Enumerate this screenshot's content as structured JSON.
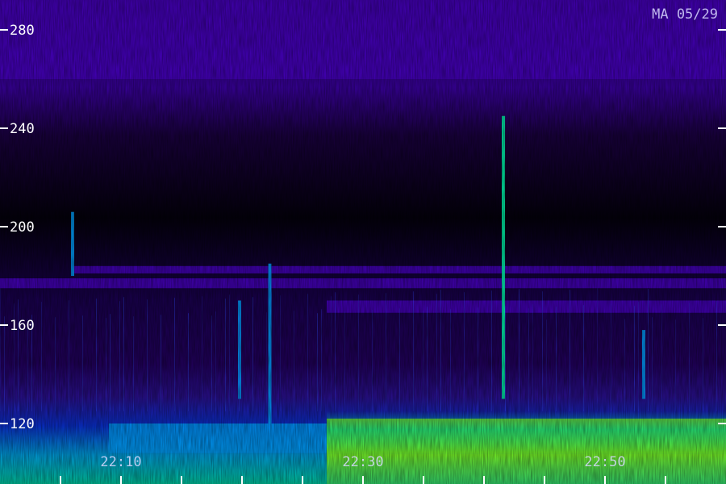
{
  "chart_data": {
    "type": "heatmap",
    "title": "",
    "corner_label": "MA 05/29",
    "xlabel": "",
    "ylabel": "",
    "ylim": [
      105,
      295
    ],
    "y_ticks": [
      120,
      160,
      200,
      240,
      280
    ],
    "x_tick_labels": [
      {
        "label": "22:10",
        "t": 10
      },
      {
        "label": "22:30",
        "t": 30
      },
      {
        "label": "22:50",
        "t": 50
      }
    ],
    "xlim": [
      0,
      60
    ],
    "x_minor_ticks": [
      5,
      10,
      15,
      20,
      25,
      30,
      35,
      40,
      45,
      50,
      55
    ],
    "colormap": [
      "#000000",
      "#2a0070",
      "#4a00c8",
      "#0030ff",
      "#00a0ff",
      "#00ffb0",
      "#a0ff00",
      "#ff2000"
    ],
    "horizontal_bands": [
      {
        "y_low": 181,
        "y_high": 184,
        "t_start": 6,
        "t_end": 60,
        "level": 0.3
      },
      {
        "y_low": 175,
        "y_high": 179,
        "t_start": 0,
        "t_end": 60,
        "level": 0.3
      },
      {
        "y_low": 165,
        "y_high": 170,
        "t_start": 27,
        "t_end": 60,
        "level": 0.35
      },
      {
        "y_low": 108,
        "y_high": 122,
        "t_start": 27,
        "t_end": 60,
        "level": 0.85
      },
      {
        "y_low": 108,
        "y_high": 120,
        "t_start": 9,
        "t_end": 27,
        "level": 0.6
      },
      {
        "y_low": 260,
        "y_high": 295,
        "t_start": 0,
        "t_end": 60,
        "level": 0.3
      }
    ],
    "vertical_bursts": [
      {
        "t": 6,
        "y_low": 180,
        "y_high": 206,
        "level": 0.5
      },
      {
        "t": 19.8,
        "y_low": 130,
        "y_high": 170,
        "level": 0.6
      },
      {
        "t": 22.3,
        "y_low": 120,
        "y_high": 185,
        "level": 0.5
      },
      {
        "t": 41.6,
        "y_low": 130,
        "y_high": 245,
        "level": 0.7
      },
      {
        "t": 53.2,
        "y_low": 130,
        "y_high": 158,
        "level": 0.5
      }
    ]
  }
}
